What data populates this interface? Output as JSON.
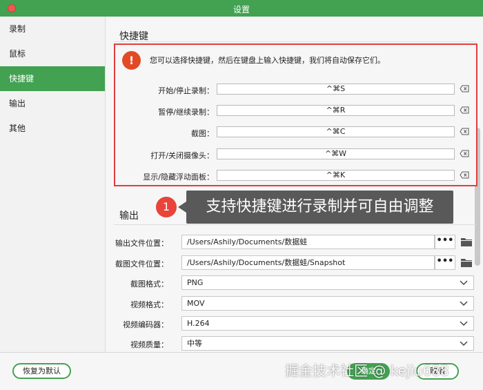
{
  "window": {
    "title": "设置"
  },
  "sidebar": {
    "items": [
      {
        "label": "录制"
      },
      {
        "label": "鼠标"
      },
      {
        "label": "快捷键",
        "active": true
      },
      {
        "label": "输出"
      },
      {
        "label": "其他"
      }
    ]
  },
  "hotkeys": {
    "section_title": "快捷键",
    "hint": "您可以选择快捷键，然后在键盘上输入快捷键，我们将自动保存它们。",
    "warn_symbol": "!",
    "rows": [
      {
        "label": "开始/停止录制：",
        "value": "^⌘S"
      },
      {
        "label": "暂停/继续录制：",
        "value": "^⌘R"
      },
      {
        "label": "截图：",
        "value": "^⌘C"
      },
      {
        "label": "打开/关闭摄像头：",
        "value": "^⌘W"
      },
      {
        "label": "显示/隐藏浮动面板：",
        "value": "^⌘K"
      }
    ]
  },
  "output": {
    "section_title": "输出",
    "output_path_label": "输出文件位置：",
    "output_path": "/Users/Ashily/Documents/数据蛙",
    "screenshot_path_label": "截图文件位置：",
    "screenshot_path": "/Users/Ashily/Documents/数据蛙/Snapshot",
    "browse_label": "•••",
    "screenshot_format_label": "截图格式：",
    "screenshot_format": "PNG",
    "video_format_label": "视频格式：",
    "video_format": "MOV",
    "video_encoder_label": "视频编码器：",
    "video_encoder": "H.264",
    "video_quality_label": "视频质量：",
    "video_quality": "中等"
  },
  "callout": {
    "number": "1",
    "text": "支持快捷键进行录制并可自由调整"
  },
  "footer": {
    "reset_label": "恢复为默认",
    "ok_label": "确定",
    "cancel_label": "取消",
    "watermark": "掘金技术社区 @ kejiu688"
  },
  "colors": {
    "accent": "#43a152",
    "highlight_border": "#e03c3c",
    "warning": "#e24a26"
  }
}
